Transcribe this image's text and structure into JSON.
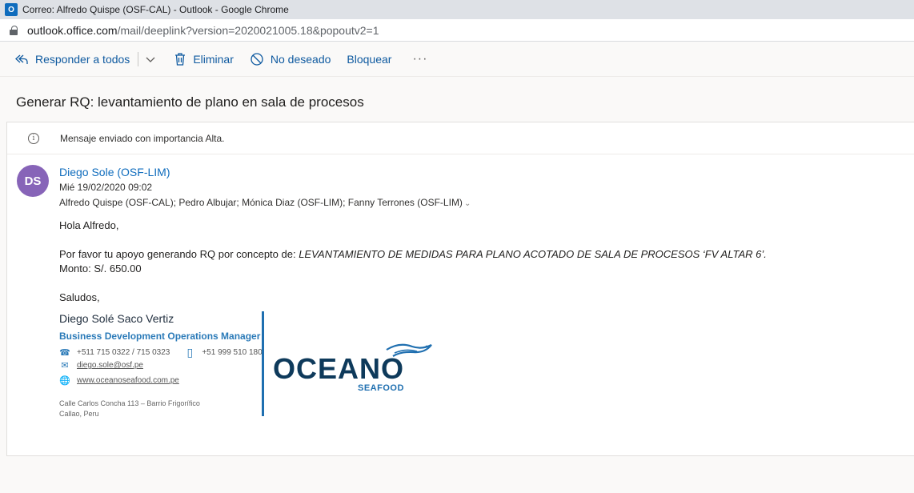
{
  "window": {
    "title": "Correo: Alfredo Quispe (OSF-CAL) - Outlook - Google Chrome",
    "app_icon_letter": "O"
  },
  "address": {
    "host": "outlook.office.com",
    "path": "/mail/deeplink?version=2020021005.18&popoutv2=1"
  },
  "commands": {
    "reply_all": "Responder a todos",
    "delete": "Eliminar",
    "junk": "No deseado",
    "block": "Bloquear",
    "more": "···"
  },
  "message": {
    "subject": "Generar RQ: levantamiento de plano en sala de procesos",
    "importance_note": "Mensaje enviado con importancia Alta.",
    "avatar_initials": "DS",
    "avatar_color": "#8764b8",
    "sender": "Diego Sole (OSF-LIM)",
    "date": "Mié 19/02/2020 09:02",
    "recipients": "Alfredo Quispe (OSF-CAL); Pedro Albujar; Mónica Diaz (OSF-LIM); Fanny Terrones (OSF-LIM)",
    "greeting": "Hola Alfredo,",
    "request_text": "Por favor tu apoyo generando RQ por concepto de: ",
    "request_item": "LEVANTAMIENTO DE MEDIDAS PARA PLANO ACOTADO DE SALA DE PROCESOS ‘FV ALTAR 6’.",
    "amount": "Monto: S/. 650.00",
    "closing": "Saludos,"
  },
  "signature": {
    "name": "Diego Solé Saco Vertiz",
    "title": "Business Development Operations Manager",
    "phones": "+511 715 0322 / 715 0323",
    "mobile": "+51 999 510 180",
    "email": "diego.sole@osf.pe",
    "website": "www.oceanoseafood.com.pe",
    "address_line1": "Calle Carlos Concha 113 – Barrio Frigorífico",
    "address_line2": "Callao, Peru",
    "logo_main": "OCEANO",
    "logo_sub": "SEAFOOD",
    "brand_color": "#1f6fb0",
    "logo_text_color": "#0e3a5b"
  }
}
